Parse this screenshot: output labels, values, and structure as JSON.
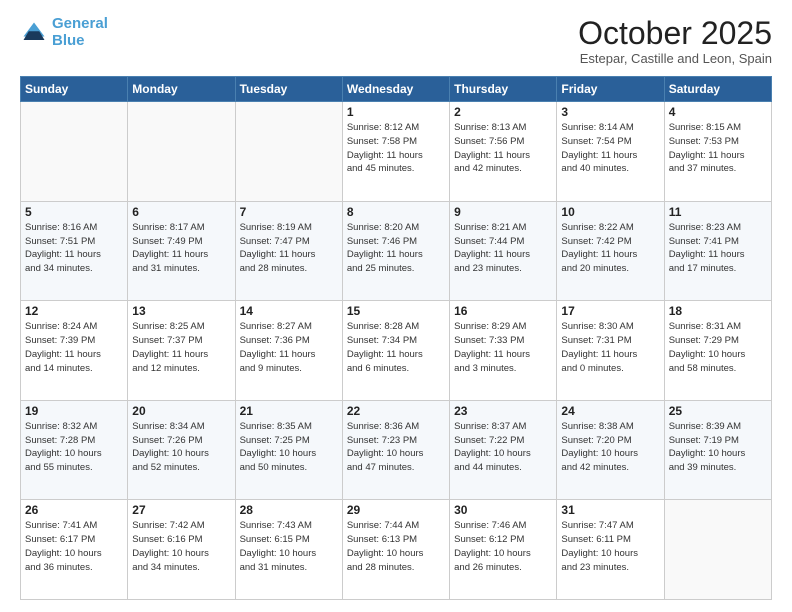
{
  "header": {
    "logo_line1": "General",
    "logo_line2": "Blue",
    "month": "October 2025",
    "location": "Estepar, Castille and Leon, Spain"
  },
  "weekdays": [
    "Sunday",
    "Monday",
    "Tuesday",
    "Wednesday",
    "Thursday",
    "Friday",
    "Saturday"
  ],
  "weeks": [
    [
      {
        "day": "",
        "info": ""
      },
      {
        "day": "",
        "info": ""
      },
      {
        "day": "",
        "info": ""
      },
      {
        "day": "1",
        "info": "Sunrise: 8:12 AM\nSunset: 7:58 PM\nDaylight: 11 hours\nand 45 minutes."
      },
      {
        "day": "2",
        "info": "Sunrise: 8:13 AM\nSunset: 7:56 PM\nDaylight: 11 hours\nand 42 minutes."
      },
      {
        "day": "3",
        "info": "Sunrise: 8:14 AM\nSunset: 7:54 PM\nDaylight: 11 hours\nand 40 minutes."
      },
      {
        "day": "4",
        "info": "Sunrise: 8:15 AM\nSunset: 7:53 PM\nDaylight: 11 hours\nand 37 minutes."
      }
    ],
    [
      {
        "day": "5",
        "info": "Sunrise: 8:16 AM\nSunset: 7:51 PM\nDaylight: 11 hours\nand 34 minutes."
      },
      {
        "day": "6",
        "info": "Sunrise: 8:17 AM\nSunset: 7:49 PM\nDaylight: 11 hours\nand 31 minutes."
      },
      {
        "day": "7",
        "info": "Sunrise: 8:19 AM\nSunset: 7:47 PM\nDaylight: 11 hours\nand 28 minutes."
      },
      {
        "day": "8",
        "info": "Sunrise: 8:20 AM\nSunset: 7:46 PM\nDaylight: 11 hours\nand 25 minutes."
      },
      {
        "day": "9",
        "info": "Sunrise: 8:21 AM\nSunset: 7:44 PM\nDaylight: 11 hours\nand 23 minutes."
      },
      {
        "day": "10",
        "info": "Sunrise: 8:22 AM\nSunset: 7:42 PM\nDaylight: 11 hours\nand 20 minutes."
      },
      {
        "day": "11",
        "info": "Sunrise: 8:23 AM\nSunset: 7:41 PM\nDaylight: 11 hours\nand 17 minutes."
      }
    ],
    [
      {
        "day": "12",
        "info": "Sunrise: 8:24 AM\nSunset: 7:39 PM\nDaylight: 11 hours\nand 14 minutes."
      },
      {
        "day": "13",
        "info": "Sunrise: 8:25 AM\nSunset: 7:37 PM\nDaylight: 11 hours\nand 12 minutes."
      },
      {
        "day": "14",
        "info": "Sunrise: 8:27 AM\nSunset: 7:36 PM\nDaylight: 11 hours\nand 9 minutes."
      },
      {
        "day": "15",
        "info": "Sunrise: 8:28 AM\nSunset: 7:34 PM\nDaylight: 11 hours\nand 6 minutes."
      },
      {
        "day": "16",
        "info": "Sunrise: 8:29 AM\nSunset: 7:33 PM\nDaylight: 11 hours\nand 3 minutes."
      },
      {
        "day": "17",
        "info": "Sunrise: 8:30 AM\nSunset: 7:31 PM\nDaylight: 11 hours\nand 0 minutes."
      },
      {
        "day": "18",
        "info": "Sunrise: 8:31 AM\nSunset: 7:29 PM\nDaylight: 10 hours\nand 58 minutes."
      }
    ],
    [
      {
        "day": "19",
        "info": "Sunrise: 8:32 AM\nSunset: 7:28 PM\nDaylight: 10 hours\nand 55 minutes."
      },
      {
        "day": "20",
        "info": "Sunrise: 8:34 AM\nSunset: 7:26 PM\nDaylight: 10 hours\nand 52 minutes."
      },
      {
        "day": "21",
        "info": "Sunrise: 8:35 AM\nSunset: 7:25 PM\nDaylight: 10 hours\nand 50 minutes."
      },
      {
        "day": "22",
        "info": "Sunrise: 8:36 AM\nSunset: 7:23 PM\nDaylight: 10 hours\nand 47 minutes."
      },
      {
        "day": "23",
        "info": "Sunrise: 8:37 AM\nSunset: 7:22 PM\nDaylight: 10 hours\nand 44 minutes."
      },
      {
        "day": "24",
        "info": "Sunrise: 8:38 AM\nSunset: 7:20 PM\nDaylight: 10 hours\nand 42 minutes."
      },
      {
        "day": "25",
        "info": "Sunrise: 8:39 AM\nSunset: 7:19 PM\nDaylight: 10 hours\nand 39 minutes."
      }
    ],
    [
      {
        "day": "26",
        "info": "Sunrise: 7:41 AM\nSunset: 6:17 PM\nDaylight: 10 hours\nand 36 minutes."
      },
      {
        "day": "27",
        "info": "Sunrise: 7:42 AM\nSunset: 6:16 PM\nDaylight: 10 hours\nand 34 minutes."
      },
      {
        "day": "28",
        "info": "Sunrise: 7:43 AM\nSunset: 6:15 PM\nDaylight: 10 hours\nand 31 minutes."
      },
      {
        "day": "29",
        "info": "Sunrise: 7:44 AM\nSunset: 6:13 PM\nDaylight: 10 hours\nand 28 minutes."
      },
      {
        "day": "30",
        "info": "Sunrise: 7:46 AM\nSunset: 6:12 PM\nDaylight: 10 hours\nand 26 minutes."
      },
      {
        "day": "31",
        "info": "Sunrise: 7:47 AM\nSunset: 6:11 PM\nDaylight: 10 hours\nand 23 minutes."
      },
      {
        "day": "",
        "info": ""
      }
    ]
  ]
}
